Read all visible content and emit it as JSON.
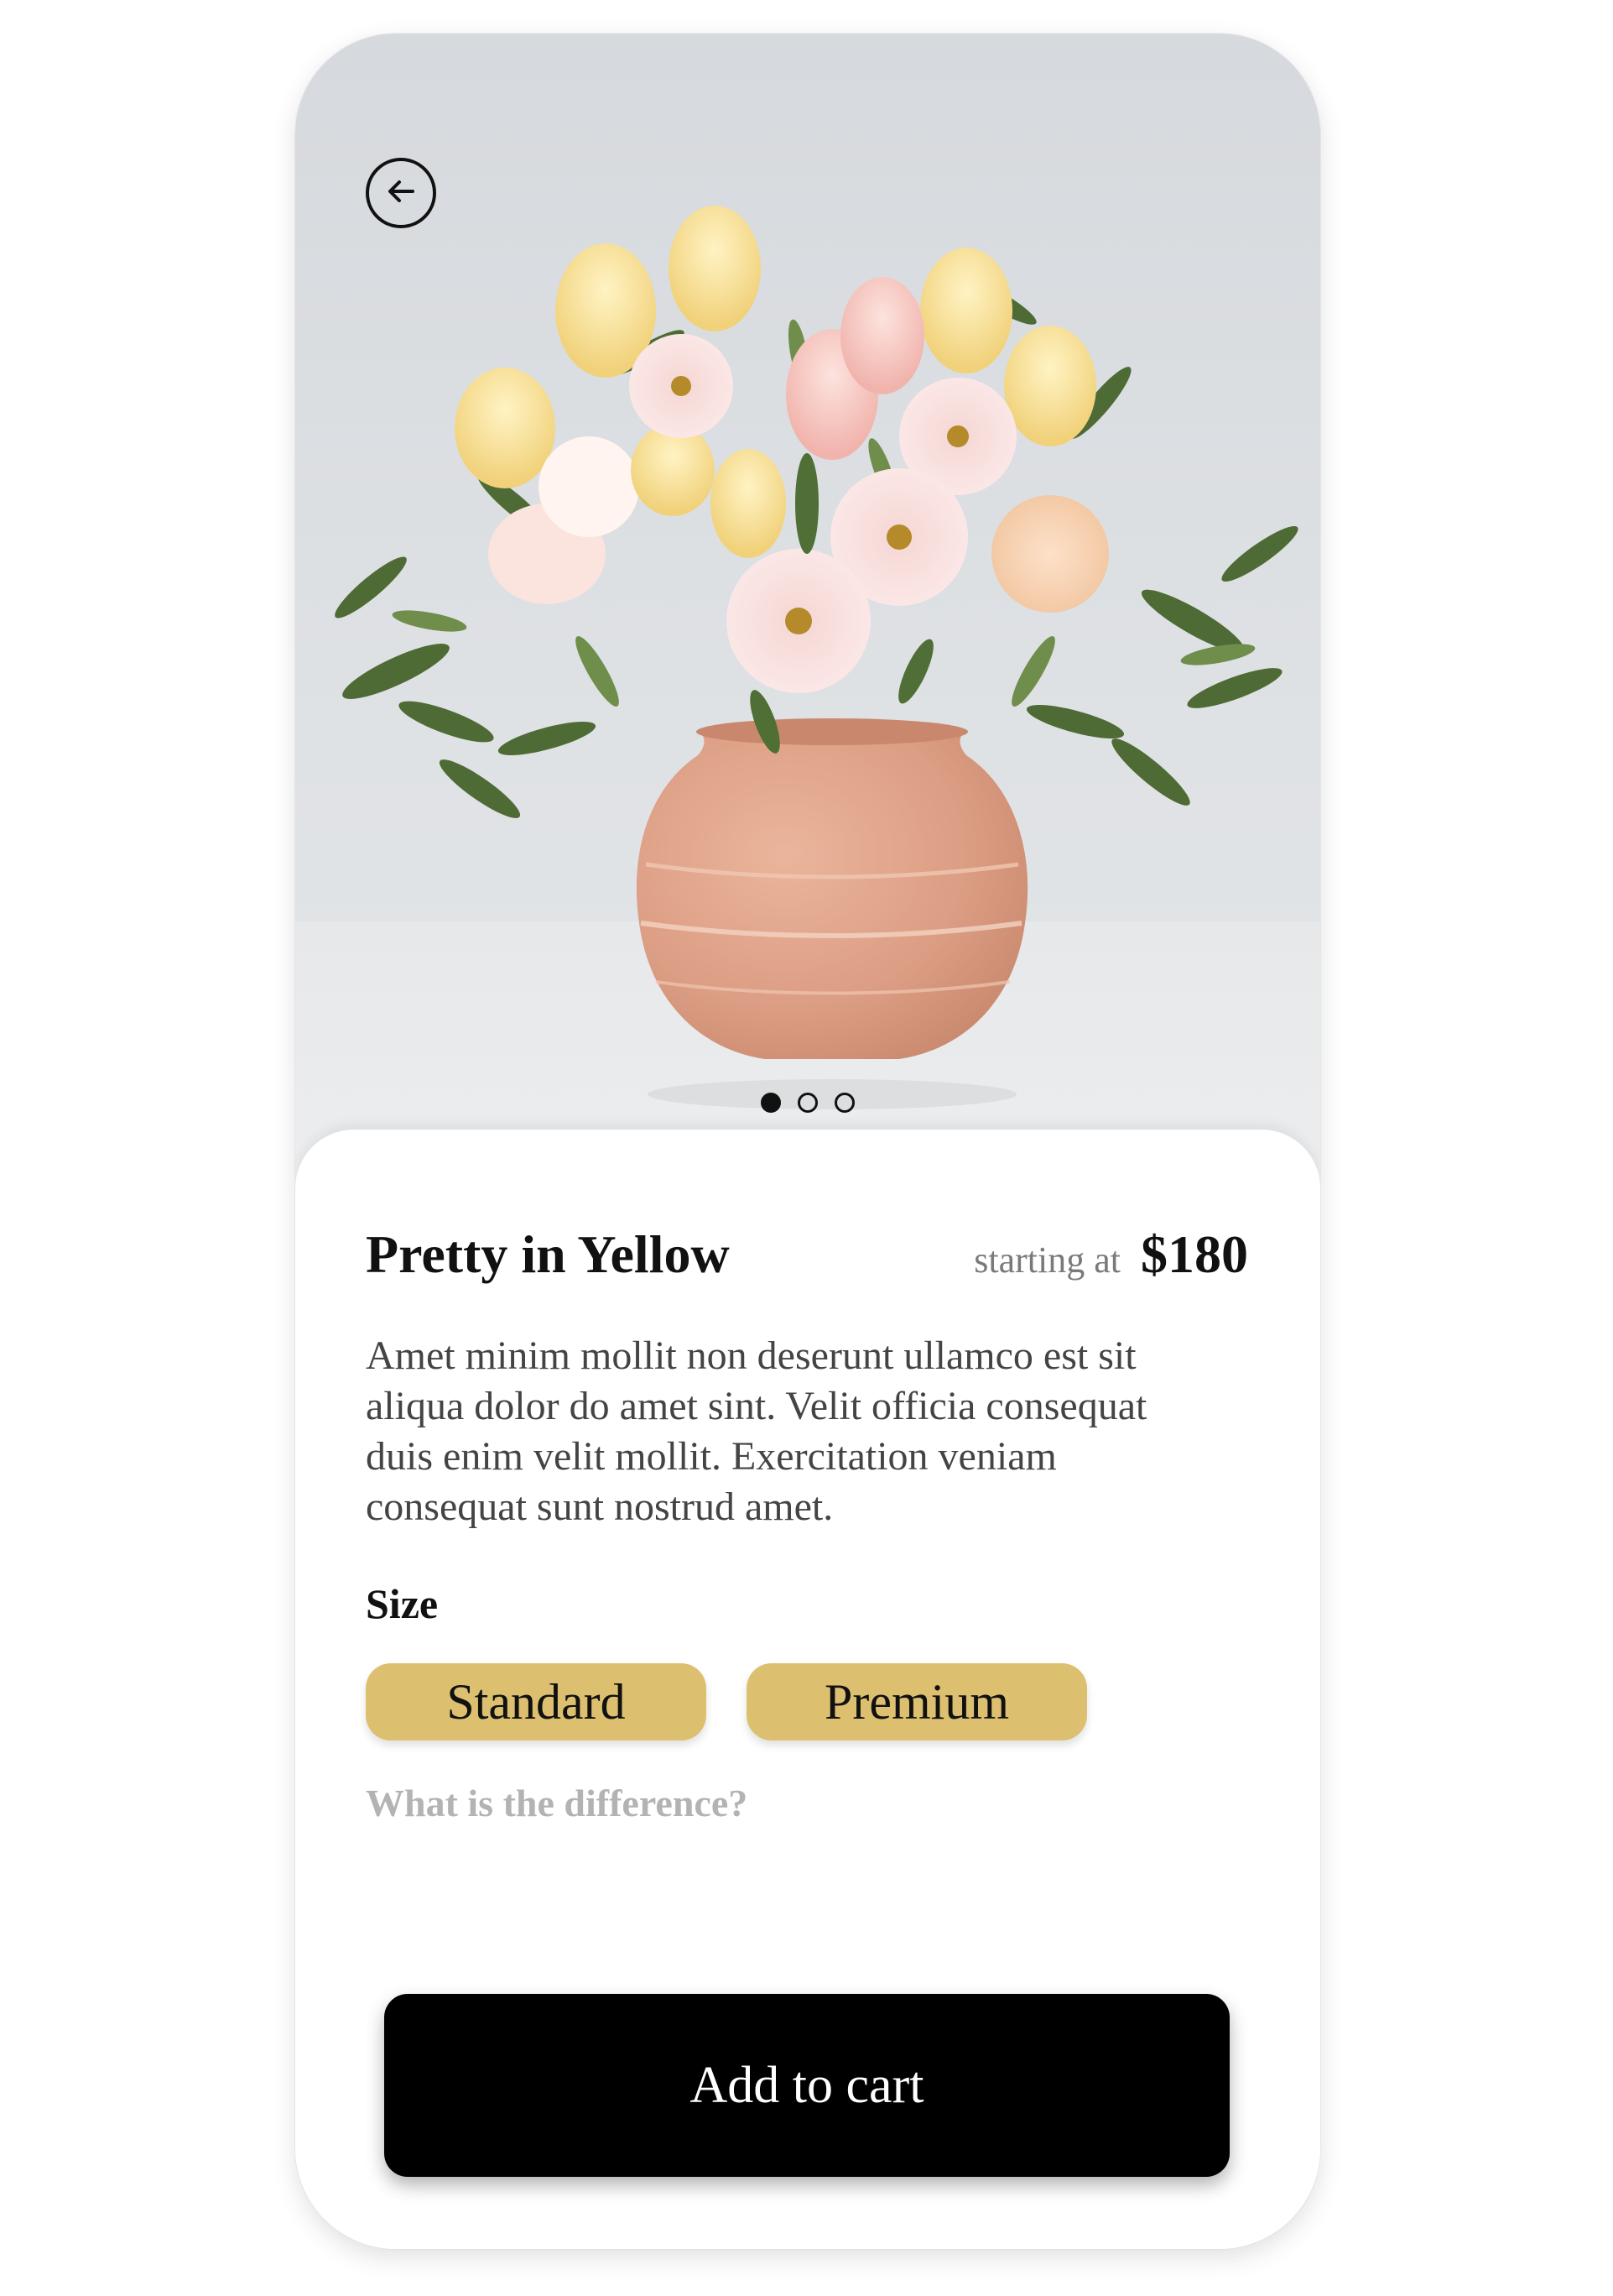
{
  "product": {
    "name": "Pretty in Yellow",
    "price_prefix": "starting at",
    "price": "$180",
    "description": "Amet minim mollit non deserunt ullamco est sit aliqua dolor do amet sint. Velit officia consequat duis enim velit mollit. Exercitation veniam consequat sunt nostrud amet."
  },
  "gallery": {
    "image_count": 3,
    "active_index": 0
  },
  "size": {
    "label": "Size",
    "options": [
      "Standard",
      "Premium"
    ],
    "difference_link": "What is the difference?"
  },
  "cart": {
    "button_label": "Add to cart"
  },
  "icons": {
    "back": "arrow-left-circle-icon"
  },
  "colors": {
    "accent_gold": "#ddc06f",
    "primary_black": "#000000",
    "muted_text": "#b3b3b3"
  }
}
